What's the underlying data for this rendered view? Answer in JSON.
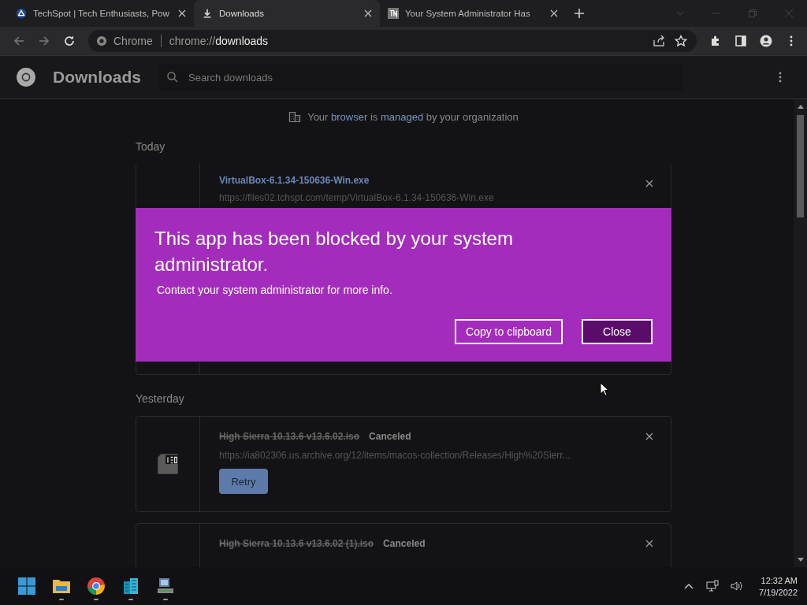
{
  "tabs": [
    {
      "title": "TechSpot | Tech Enthusiasts, Pow",
      "kind": "site",
      "selected": false
    },
    {
      "title": "Downloads",
      "kind": "download",
      "selected": true
    },
    {
      "title": "Your System Administrator Has",
      "kind": "tn",
      "selected": false
    }
  ],
  "address": {
    "label": "Chrome",
    "url_scheme": "chrome://",
    "url_path": "downloads"
  },
  "header": {
    "title": "Downloads",
    "search_placeholder": "Search downloads"
  },
  "managed_notice": [
    {
      "text": "Your ",
      "link": false
    },
    {
      "text": "browser",
      "link": true
    },
    {
      "text": " is ",
      "link": false
    },
    {
      "text": "managed",
      "link": true
    },
    {
      "text": " by your organization",
      "link": false
    }
  ],
  "groups": [
    {
      "date": "Today",
      "items": [
        {
          "file": "VirtualBox-6.1.34-150636-Win.exe",
          "canceled": false,
          "url": "https://files02.tchspt.com/temp/VirtualBox-6.1.34-150636-Win.exe"
        }
      ]
    },
    {
      "date": "Yesterday",
      "items": [
        {
          "file": "High Sierra 10.13.6 v13.6.02.iso",
          "canceled": true,
          "status": "Canceled",
          "url": "https://ia802306.us.archive.org/12/items/macos-collection/Releases/High%20Sierr...",
          "action": "Retry"
        },
        {
          "file": "High Sierra 10.13.6 v13.6.02 (1).iso",
          "canceled": true,
          "status": "Canceled"
        }
      ]
    }
  ],
  "dialog": {
    "title": "This app has been blocked by your system administrator.",
    "message": "Contact your system administrator for more info.",
    "buttons": [
      {
        "label": "Copy to clipboard",
        "kind": "secondary"
      },
      {
        "label": "Close",
        "kind": "primary"
      }
    ]
  },
  "taskbar": {
    "apps": [
      {
        "kind": "start",
        "running": false
      },
      {
        "kind": "folder",
        "running": true
      },
      {
        "kind": "chrome",
        "running": true
      },
      {
        "kind": "buildings",
        "running": true
      },
      {
        "kind": "computer",
        "running": true
      }
    ],
    "time": "12:32 AM",
    "date": "7/19/2022"
  }
}
